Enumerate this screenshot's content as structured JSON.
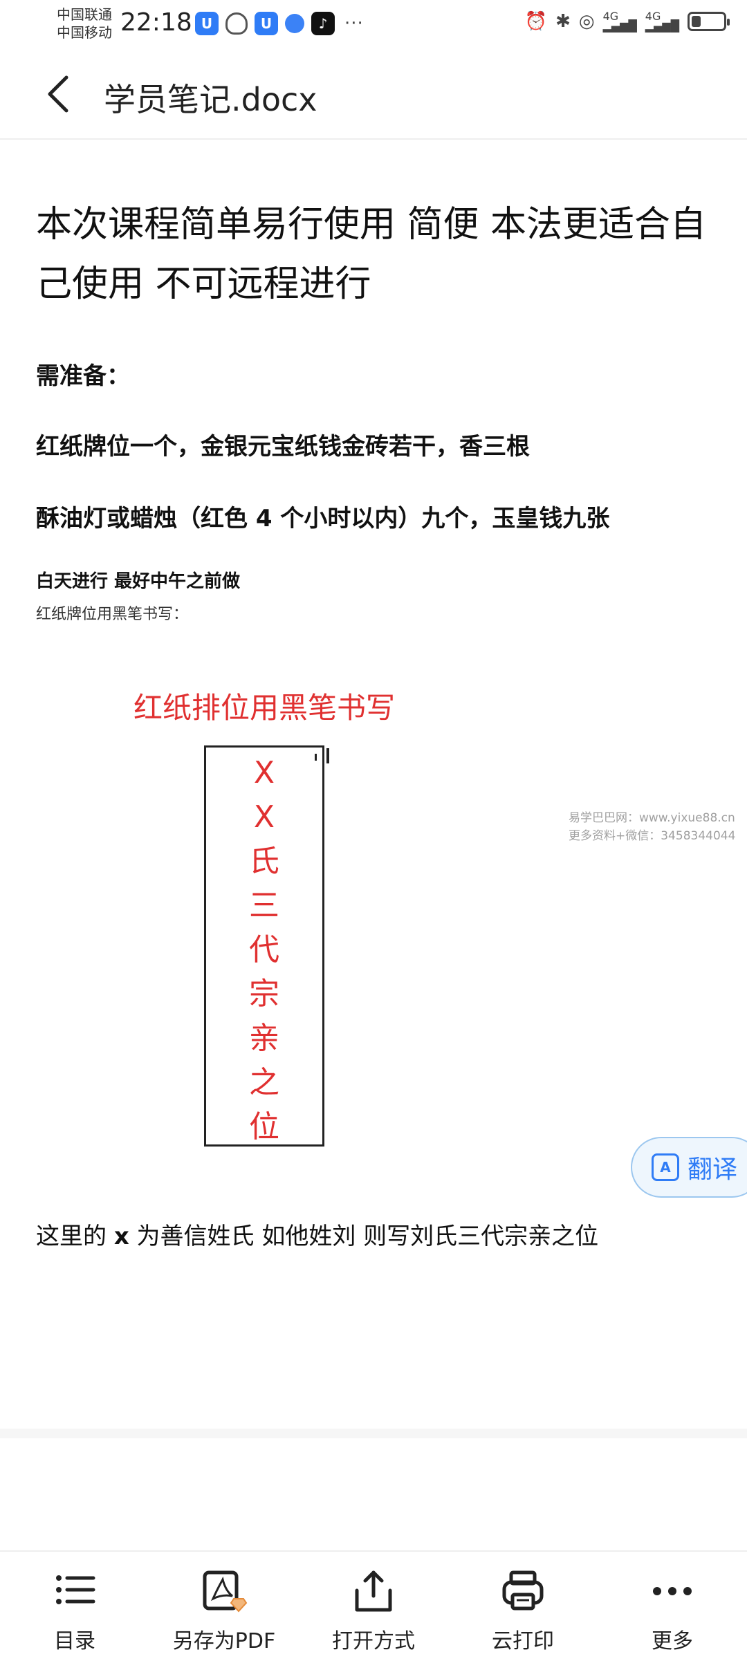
{
  "status_bar": {
    "carrier_1": "中国联通",
    "carrier_2": "中国移动",
    "time": "22:18",
    "network_1": "4G",
    "network_2": "4G",
    "battery_level": 0.3
  },
  "header": {
    "title": "学员笔记.docx"
  },
  "document": {
    "heading": "本次课程简单易行使用  简便  本法更适合自己使用    不可远程进行",
    "para_1": "需准备：",
    "para_2": "红纸牌位一个，金银元宝纸钱金砖若干，香三根",
    "para_3": "酥油灯或蜡烛（红色 4 个小时以内）九个，玉皇钱九张",
    "para_4": "白天进行  最好中午之前做",
    "para_5": "红纸牌位用黑笔书写：",
    "image": {
      "title": "红纸排位用黑笔书写",
      "tablet_chars": [
        "X",
        "X",
        "氏",
        "三",
        "代",
        "宗",
        "亲",
        "之",
        "位"
      ]
    },
    "watermark_1": "易学巴巴网：www.yixue88.cn",
    "watermark_2": "更多资料+微信：3458344044",
    "para_last_a": "这里的 ",
    "para_last_b": "x",
    "para_last_c": " 为善信姓氏  如他姓刘  则写刘氏三代宗亲之位"
  },
  "translate": {
    "label": "翻译"
  },
  "toolbar": {
    "items": [
      {
        "label": "目录",
        "icon": "list-icon"
      },
      {
        "label": "另存为PDF",
        "icon": "pdf-icon"
      },
      {
        "label": "打开方式",
        "icon": "share-icon"
      },
      {
        "label": "云打印",
        "icon": "printer-icon"
      },
      {
        "label": "更多",
        "icon": "more-icon"
      }
    ]
  }
}
